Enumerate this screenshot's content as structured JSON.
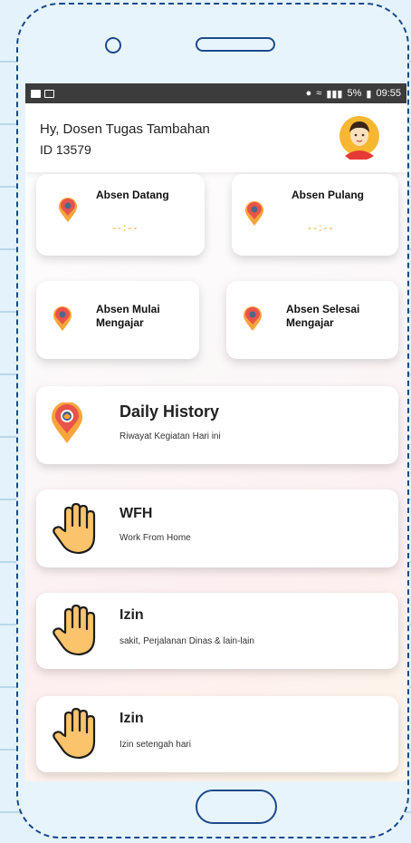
{
  "status_bar": {
    "battery": "5%",
    "time": "09:55"
  },
  "header": {
    "greeting": "Hy, Dosen Tugas Tambahan",
    "user_id": "ID 13579"
  },
  "attendance": {
    "datang": {
      "label": "Absen Datang",
      "time": "--:--"
    },
    "pulang": {
      "label": "Absen Pulang",
      "time": "--:--"
    },
    "mulai": {
      "label": "Absen Mulai\nMengajar"
    },
    "selesai": {
      "label": "Absen Selesai\nMengajar"
    }
  },
  "menu": [
    {
      "title": "Daily History",
      "subtitle": "Riwayat Kegiatan Hari ini"
    },
    {
      "title": "WFH",
      "subtitle": "Work From Home"
    },
    {
      "title": "Izin",
      "subtitle": "sakit, Perjalanan Dinas & lain-lain"
    },
    {
      "title": "Izin",
      "subtitle": "Izin setengah hari"
    }
  ],
  "colors": {
    "accent": "#f5a623",
    "pin_red": "#e8534a",
    "pin_orange": "#f7a43b",
    "status_bar": "#3c3c3c"
  }
}
